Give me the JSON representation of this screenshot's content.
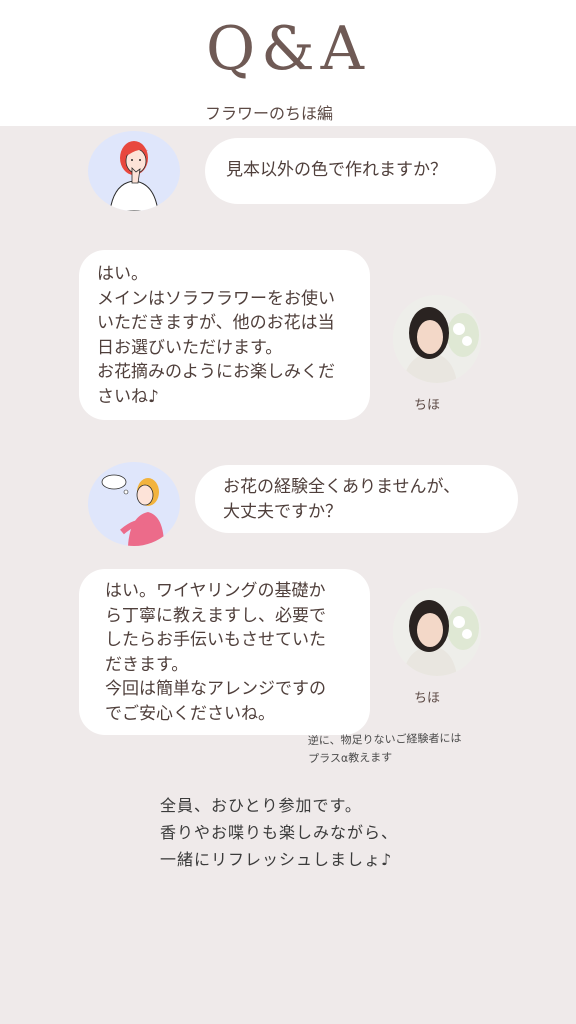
{
  "header": {
    "title": "Q&A",
    "subtitle": "フラワーのちほ編"
  },
  "qa": [
    {
      "question": "見本以外の色で作れますか？",
      "answer_lines": [
        "はい。",
        "メインはソラフラワーをお使い",
        "いただきますが、他のお花は当",
        "日お選びいただけます。",
        "お花摘みのようにお楽しみくだ",
        "さいね♪"
      ],
      "answerer": "ちほ"
    },
    {
      "question_lines": [
        "お花の経験全くありませんが、",
        "大丈夫ですか？"
      ],
      "answer_lines": [
        "はい。ワイヤリングの基礎か",
        "ら丁寧に教えますし、必要で",
        "したらお手伝いもさせていた",
        "だきます。",
        "今回は簡単なアレンジですの",
        "でご安心くださいね。"
      ],
      "answerer": "ちほ"
    }
  ],
  "note_lines": [
    "逆に、物足りないご経験者には",
    "プラスα教えます"
  ],
  "footer_lines": [
    "全員、おひとり参加です。",
    "香りやお喋りも楽しみながら、",
    "一緒にリフレッシュしましょ♪"
  ]
}
